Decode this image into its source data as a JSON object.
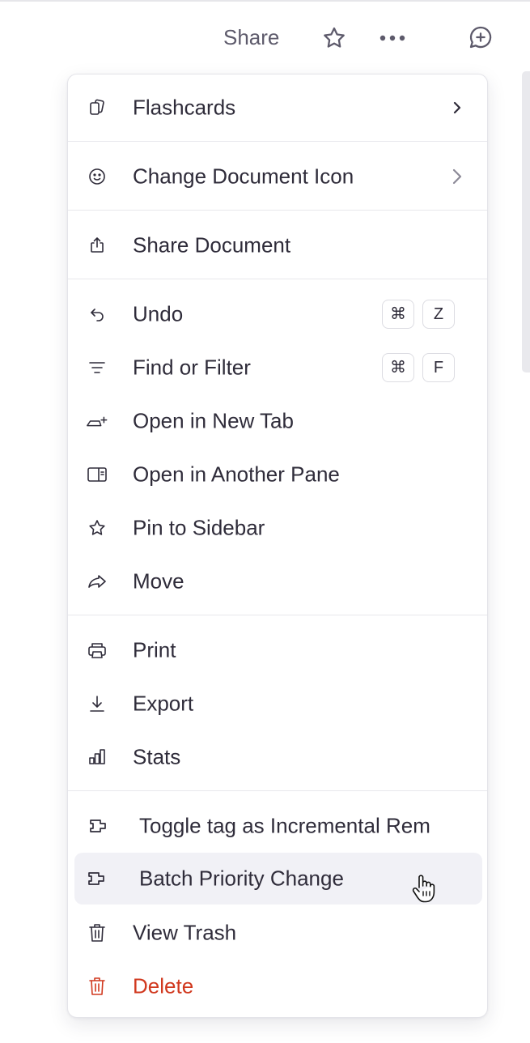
{
  "topbar": {
    "share_label": "Share",
    "icons": [
      "star-icon",
      "more-horizontal-icon",
      "add-comment-icon"
    ]
  },
  "menu": {
    "flashcards": "Flashcards",
    "change_icon": "Change Document Icon",
    "share_document": "Share Document",
    "undo": {
      "label": "Undo",
      "keys": [
        "⌘",
        "Z"
      ]
    },
    "find": {
      "label": "Find or Filter",
      "keys": [
        "⌘",
        "F"
      ]
    },
    "open_new_tab": "Open in New Tab",
    "open_another_pane": "Open in Another Pane",
    "pin_sidebar": "Pin to Sidebar",
    "move": "Move",
    "print": "Print",
    "export": "Export",
    "stats": "Stats",
    "toggle_tag": "Toggle tag as Incremental Rem",
    "batch_priority": "Batch Priority Change",
    "view_trash": "View Trash",
    "delete": "Delete"
  },
  "colors": {
    "danger": "#d1391f",
    "hover_bg": "#f1f1f6",
    "text": "#2f2c3a"
  }
}
